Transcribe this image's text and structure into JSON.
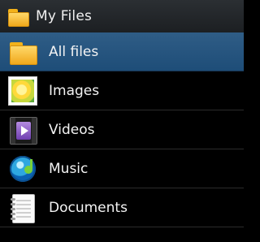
{
  "header": {
    "title": "My Files",
    "icon": "folder-icon"
  },
  "list": {
    "items": [
      {
        "label": "All files",
        "icon": "folder-icon",
        "selected": true
      },
      {
        "label": "Images",
        "icon": "images-icon",
        "selected": false
      },
      {
        "label": "Videos",
        "icon": "videos-icon",
        "selected": false
      },
      {
        "label": "Music",
        "icon": "music-icon",
        "selected": false
      },
      {
        "label": "Documents",
        "icon": "documents-icon",
        "selected": false
      }
    ]
  },
  "colors": {
    "background": "#000000",
    "header": "#222629",
    "selected": "#2a5a86",
    "divider": "#2b2b2b",
    "text": "#f3f3f3",
    "folder": "#f4b51c"
  }
}
